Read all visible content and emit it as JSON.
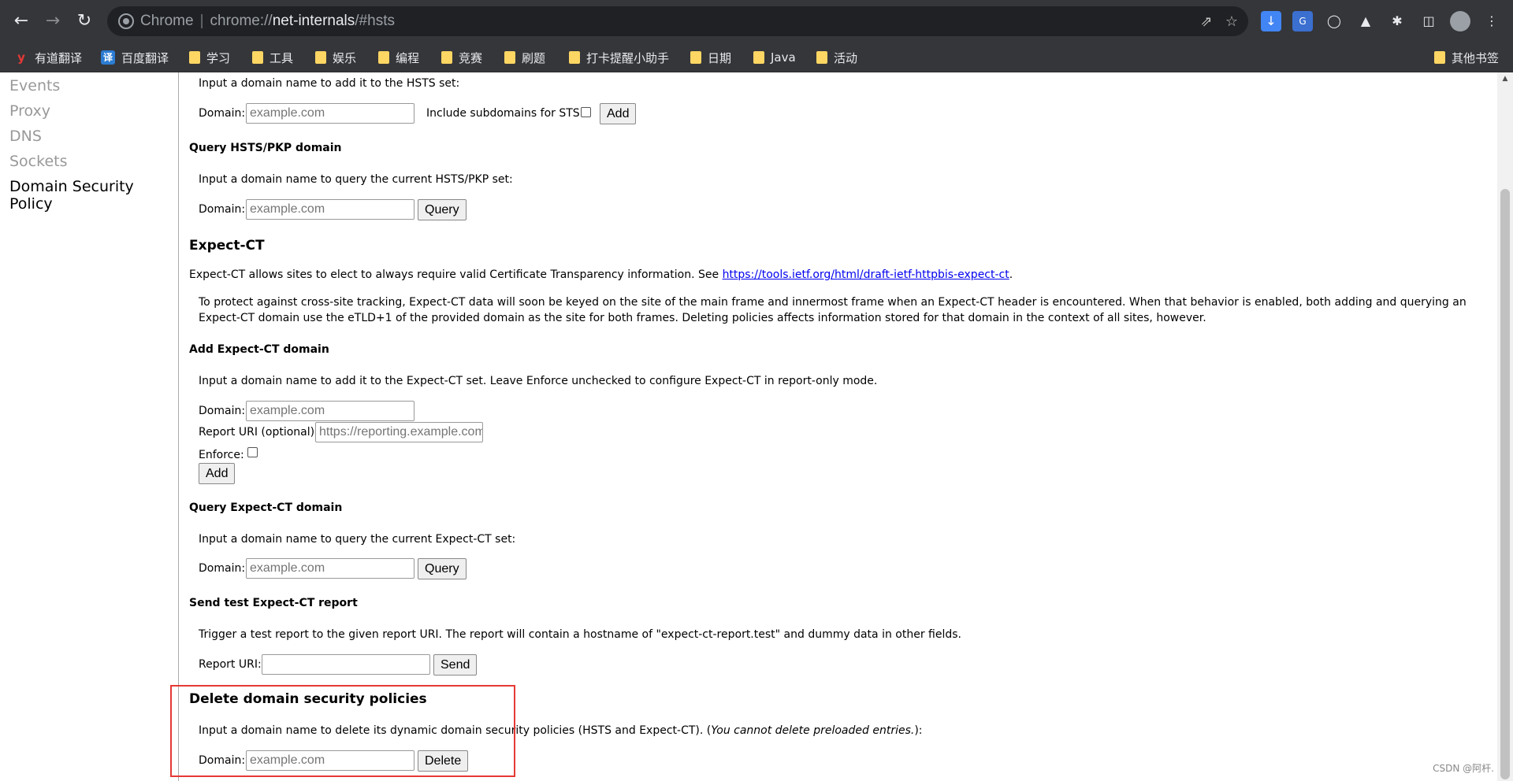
{
  "browser": {
    "url_prefix": "Chrome",
    "url_scheme": "chrome://",
    "url_host": "net-internals",
    "url_path": "/#hsts"
  },
  "bookmarks": [
    {
      "label": "有道翻译",
      "icon": "youdao-logo"
    },
    {
      "label": "百度翻译",
      "icon": "baidu-translate-logo"
    },
    {
      "label": "学习",
      "icon": "folder"
    },
    {
      "label": "工具",
      "icon": "folder"
    },
    {
      "label": "娱乐",
      "icon": "folder"
    },
    {
      "label": "编程",
      "icon": "folder"
    },
    {
      "label": "竞赛",
      "icon": "folder"
    },
    {
      "label": "刷题",
      "icon": "folder"
    },
    {
      "label": "打卡提醒小助手",
      "icon": "folder"
    },
    {
      "label": "日期",
      "icon": "folder"
    },
    {
      "label": "Java",
      "icon": "folder"
    },
    {
      "label": "活动",
      "icon": "folder"
    },
    {
      "label": "其他书签",
      "icon": "folder"
    }
  ],
  "sidebar": {
    "items": [
      {
        "label": "Events"
      },
      {
        "label": "Proxy"
      },
      {
        "label": "DNS"
      },
      {
        "label": "Sockets"
      },
      {
        "label": "Domain Security Policy"
      }
    ]
  },
  "hsts_add": {
    "intro": "Input a domain name to add it to the HSTS set:",
    "domain_label": "Domain:",
    "domain_placeholder": "example.com",
    "subdomains_label": "Include subdomains for STS:",
    "add_label": "Add"
  },
  "hsts_query": {
    "title": "Query HSTS/PKP domain",
    "intro": "Input a domain name to query the current HSTS/PKP set:",
    "domain_label": "Domain:",
    "domain_placeholder": "example.com",
    "query_label": "Query"
  },
  "expect_ct": {
    "title": "Expect-CT",
    "desc_prefix": "Expect-CT allows sites to elect to always require valid Certificate Transparency information. See",
    "desc_link": "https://tools.ietf.org/html/draft-ietf-httpbis-expect-ct",
    "desc_suffix": ".",
    "note": "To protect against cross-site tracking, Expect-CT data will soon be keyed on the site of the main frame and innermost frame when an Expect-CT header is encountered. When that behavior is enabled, both adding and querying an Expect-CT domain use the eTLD+1 of the provided domain as the site for both frames. Deleting policies affects information stored for that domain in the context of all sites, however."
  },
  "expect_ct_add": {
    "title": "Add Expect-CT domain",
    "intro": "Input a domain name to add it to the Expect-CT set. Leave Enforce unchecked to configure Expect-CT in report-only mode.",
    "domain_label": "Domain:",
    "domain_placeholder": "example.com",
    "report_label": "Report URI (optional):",
    "report_placeholder": "https://reporting.example.com",
    "enforce_label": "Enforce:",
    "add_label": "Add"
  },
  "expect_ct_query": {
    "title": "Query Expect-CT domain",
    "intro": "Input a domain name to query the current Expect-CT set:",
    "domain_label": "Domain:",
    "domain_placeholder": "example.com",
    "query_label": "Query"
  },
  "expect_ct_test": {
    "title": "Send test Expect-CT report",
    "intro": "Trigger a test report to the given report URI. The report will contain a hostname of \"expect-ct-report.test\" and dummy data in other fields.",
    "report_label": "Report URI:",
    "report_value": "",
    "send_label": "Send"
  },
  "delete_policies": {
    "title": "Delete domain security policies",
    "intro": "Input a domain name to delete its dynamic domain security policies (HSTS and Expect-CT). (",
    "intro_italic": "You cannot delete preloaded entries.",
    "intro_end": "):",
    "domain_label": "Domain:",
    "domain_placeholder": "example.com",
    "delete_label": "Delete"
  },
  "watermark": "CSDN @阿杆.",
  "colors": {
    "highlight_border": "#e53935",
    "link": "#0000ee",
    "folder": "#fdd663"
  }
}
